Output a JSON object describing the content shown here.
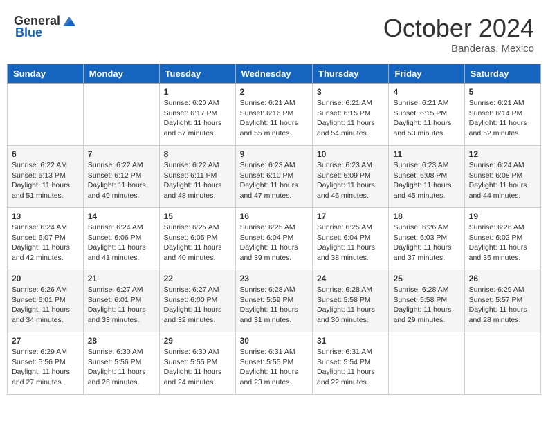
{
  "header": {
    "logo_general": "General",
    "logo_blue": "Blue",
    "month": "October 2024",
    "location": "Banderas, Mexico"
  },
  "weekdays": [
    "Sunday",
    "Monday",
    "Tuesday",
    "Wednesday",
    "Thursday",
    "Friday",
    "Saturday"
  ],
  "weeks": [
    [
      {
        "day": "",
        "info": ""
      },
      {
        "day": "",
        "info": ""
      },
      {
        "day": "1",
        "info": "Sunrise: 6:20 AM\nSunset: 6:17 PM\nDaylight: 11 hours and 57 minutes."
      },
      {
        "day": "2",
        "info": "Sunrise: 6:21 AM\nSunset: 6:16 PM\nDaylight: 11 hours and 55 minutes."
      },
      {
        "day": "3",
        "info": "Sunrise: 6:21 AM\nSunset: 6:15 PM\nDaylight: 11 hours and 54 minutes."
      },
      {
        "day": "4",
        "info": "Sunrise: 6:21 AM\nSunset: 6:15 PM\nDaylight: 11 hours and 53 minutes."
      },
      {
        "day": "5",
        "info": "Sunrise: 6:21 AM\nSunset: 6:14 PM\nDaylight: 11 hours and 52 minutes."
      }
    ],
    [
      {
        "day": "6",
        "info": "Sunrise: 6:22 AM\nSunset: 6:13 PM\nDaylight: 11 hours and 51 minutes."
      },
      {
        "day": "7",
        "info": "Sunrise: 6:22 AM\nSunset: 6:12 PM\nDaylight: 11 hours and 49 minutes."
      },
      {
        "day": "8",
        "info": "Sunrise: 6:22 AM\nSunset: 6:11 PM\nDaylight: 11 hours and 48 minutes."
      },
      {
        "day": "9",
        "info": "Sunrise: 6:23 AM\nSunset: 6:10 PM\nDaylight: 11 hours and 47 minutes."
      },
      {
        "day": "10",
        "info": "Sunrise: 6:23 AM\nSunset: 6:09 PM\nDaylight: 11 hours and 46 minutes."
      },
      {
        "day": "11",
        "info": "Sunrise: 6:23 AM\nSunset: 6:08 PM\nDaylight: 11 hours and 45 minutes."
      },
      {
        "day": "12",
        "info": "Sunrise: 6:24 AM\nSunset: 6:08 PM\nDaylight: 11 hours and 44 minutes."
      }
    ],
    [
      {
        "day": "13",
        "info": "Sunrise: 6:24 AM\nSunset: 6:07 PM\nDaylight: 11 hours and 42 minutes."
      },
      {
        "day": "14",
        "info": "Sunrise: 6:24 AM\nSunset: 6:06 PM\nDaylight: 11 hours and 41 minutes."
      },
      {
        "day": "15",
        "info": "Sunrise: 6:25 AM\nSunset: 6:05 PM\nDaylight: 11 hours and 40 minutes."
      },
      {
        "day": "16",
        "info": "Sunrise: 6:25 AM\nSunset: 6:04 PM\nDaylight: 11 hours and 39 minutes."
      },
      {
        "day": "17",
        "info": "Sunrise: 6:25 AM\nSunset: 6:04 PM\nDaylight: 11 hours and 38 minutes."
      },
      {
        "day": "18",
        "info": "Sunrise: 6:26 AM\nSunset: 6:03 PM\nDaylight: 11 hours and 37 minutes."
      },
      {
        "day": "19",
        "info": "Sunrise: 6:26 AM\nSunset: 6:02 PM\nDaylight: 11 hours and 35 minutes."
      }
    ],
    [
      {
        "day": "20",
        "info": "Sunrise: 6:26 AM\nSunset: 6:01 PM\nDaylight: 11 hours and 34 minutes."
      },
      {
        "day": "21",
        "info": "Sunrise: 6:27 AM\nSunset: 6:01 PM\nDaylight: 11 hours and 33 minutes."
      },
      {
        "day": "22",
        "info": "Sunrise: 6:27 AM\nSunset: 6:00 PM\nDaylight: 11 hours and 32 minutes."
      },
      {
        "day": "23",
        "info": "Sunrise: 6:28 AM\nSunset: 5:59 PM\nDaylight: 11 hours and 31 minutes."
      },
      {
        "day": "24",
        "info": "Sunrise: 6:28 AM\nSunset: 5:58 PM\nDaylight: 11 hours and 30 minutes."
      },
      {
        "day": "25",
        "info": "Sunrise: 6:28 AM\nSunset: 5:58 PM\nDaylight: 11 hours and 29 minutes."
      },
      {
        "day": "26",
        "info": "Sunrise: 6:29 AM\nSunset: 5:57 PM\nDaylight: 11 hours and 28 minutes."
      }
    ],
    [
      {
        "day": "27",
        "info": "Sunrise: 6:29 AM\nSunset: 5:56 PM\nDaylight: 11 hours and 27 minutes."
      },
      {
        "day": "28",
        "info": "Sunrise: 6:30 AM\nSunset: 5:56 PM\nDaylight: 11 hours and 26 minutes."
      },
      {
        "day": "29",
        "info": "Sunrise: 6:30 AM\nSunset: 5:55 PM\nDaylight: 11 hours and 24 minutes."
      },
      {
        "day": "30",
        "info": "Sunrise: 6:31 AM\nSunset: 5:55 PM\nDaylight: 11 hours and 23 minutes."
      },
      {
        "day": "31",
        "info": "Sunrise: 6:31 AM\nSunset: 5:54 PM\nDaylight: 11 hours and 22 minutes."
      },
      {
        "day": "",
        "info": ""
      },
      {
        "day": "",
        "info": ""
      }
    ]
  ]
}
